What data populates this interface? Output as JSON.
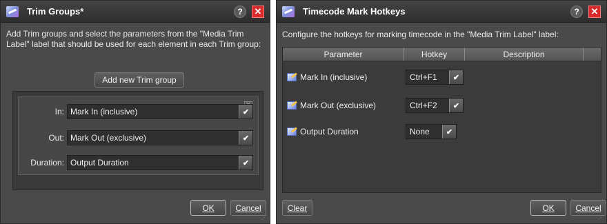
{
  "trim_dialog": {
    "title": "Trim Groups*",
    "help": "?",
    "close": "✕",
    "instructions": "Add Trim groups and select the parameters from the \"Media Trim Label\" label that should be used for each element in each Trim group:",
    "add_button": "Add new Trim group",
    "group": {
      "remove": "✕",
      "in_label": "In:",
      "in_value": "Mark In (inclusive)",
      "out_label": "Out:",
      "out_value": "Mark Out (exclusive)",
      "duration_label": "Duration:",
      "duration_value": "Output Duration"
    },
    "ok": "OK",
    "cancel": "Cancel"
  },
  "hotkey_dialog": {
    "title": "Timecode Mark Hotkeys",
    "help": "?",
    "close": "✕",
    "instructions": "Configure the hotkeys for marking timecode in the \"Media Trim Label\" label:",
    "columns": [
      "Parameter",
      "Hotkey",
      "Description"
    ],
    "rows": [
      {
        "parameter": "Mark In (inclusive)",
        "hotkey": "Ctrl+F1"
      },
      {
        "parameter": "Mark Out (exclusive)",
        "hotkey": "Ctrl+F2"
      },
      {
        "parameter": "Output Duration",
        "hotkey": "None"
      }
    ],
    "clear": "Clear",
    "ok": "OK",
    "cancel": "Cancel"
  }
}
